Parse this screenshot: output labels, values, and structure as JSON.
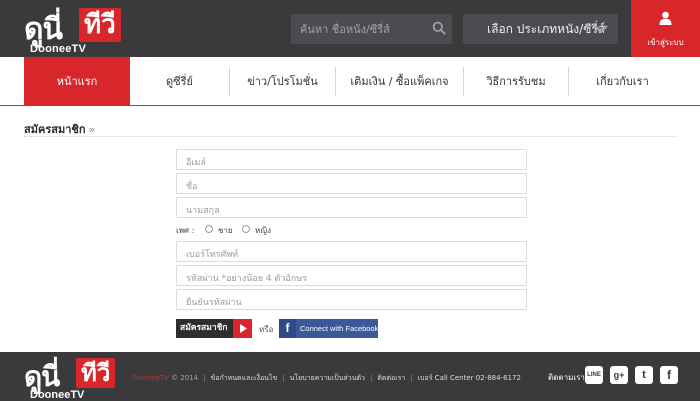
{
  "brand": {
    "logo_thai_dark": "ดูนี่",
    "logo_thai_red": "ทีวี",
    "logo_latin": "DooneeTV"
  },
  "header": {
    "search_placeholder": "ค้นหา ชื่อหนัง/ซีรี่ส์",
    "category_select": "เลือก ประเภทหนัง/ซีรี่ส์",
    "login_label": "เข้าสู่ระบบ"
  },
  "nav": {
    "items": [
      {
        "label": "หน้าแรก",
        "active": true
      },
      {
        "label": "ดูซีรี่ย์"
      },
      {
        "label": "ข่าว/โปรโมชั่น"
      },
      {
        "label": "เติมเงิน / ซื้อแพ็คเกจ"
      },
      {
        "label": "วิธีการรับชม"
      },
      {
        "label": "เกี่ยวกับเรา"
      }
    ]
  },
  "page": {
    "title": "สมัครสมาชิก",
    "title_chevron": "»"
  },
  "form": {
    "email_placeholder": "อีเมล์",
    "name_placeholder": "ชื่อ",
    "lastname_placeholder": "นามสกุล",
    "gender_label": "เพศ :",
    "gender_male": "ชาย",
    "gender_female": "หญิง",
    "phone_placeholder": "เบอร์โทรศัพท์",
    "password_placeholder": "รหัสผ่าน *อย่างน้อย 4 ตัวอักษร",
    "confirm_placeholder": "ยืนยันรหัสผ่าน",
    "submit_label": "สมัครสมาชิก",
    "or_label": "หรือ",
    "facebook_icon": "f",
    "facebook_label": "Connect with Facebook"
  },
  "footer": {
    "brand": "DooneeTV",
    "copyright": "© 2014",
    "links": [
      "ข้อกำหนดและเงื่อนไข",
      "นโยบายความเป็นส่วนตัว",
      "ติดต่อเรา",
      "เบอร์ Call Center 02-884-6172"
    ],
    "follow_label": "ติดตามเรา",
    "social": {
      "line": "LINE",
      "gplus": "g+",
      "twitter": "t",
      "facebook": "f"
    }
  },
  "colors": {
    "brand_red": "#d8262b",
    "dark_bg": "#3a3a3d",
    "facebook_blue": "#3b5998"
  },
  "icons": [
    "search-icon",
    "chevron-down-icon",
    "user-icon",
    "play-icon",
    "facebook-icon",
    "line-icon",
    "google-plus-icon",
    "twitter-icon"
  ]
}
